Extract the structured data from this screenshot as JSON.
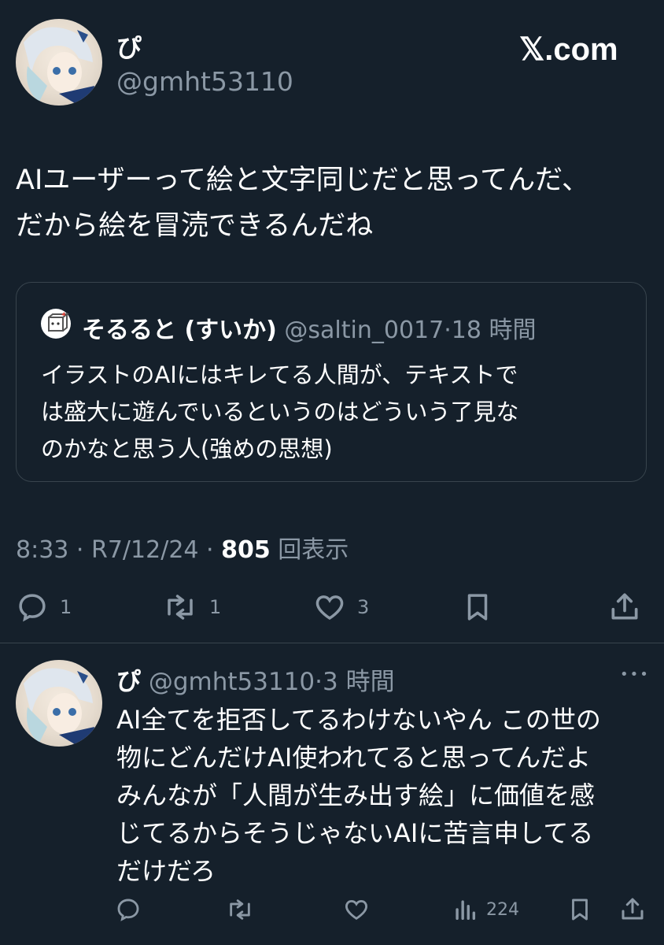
{
  "main_tweet": {
    "display_name": "ぴ",
    "handle": "@gmht53110",
    "site_label": "𝕏.com",
    "text_line1": "AIユーザーって絵と文字同じだと思ってんだ、",
    "text_line2": "だから絵を冒涜できるんだね",
    "quoted": {
      "display_name": "そるると (すいか)",
      "handle": "@saltin_0017",
      "time": "·18 時間",
      "line1": "イラストのAIにはキレてる人間が、テキストで",
      "line2": "は盛大に遊んでいるというのはどういう了見な",
      "line3": "のかなと思う人(強めの思想)"
    },
    "time": "8:33",
    "date": "· R7/12/24 ·",
    "views_count": "805",
    "views_label": "回表示",
    "replies": "1",
    "retweets": "1",
    "likes": "3"
  },
  "reply_tweet": {
    "display_name": "ぴ",
    "handle": "@gmht53110",
    "time": "·3 時間",
    "more": "•••",
    "line1": "AI全てを拒否してるわけないやん  この世の",
    "line2": "物にどんだけAI使われてると思ってんだよ",
    "line3": "みんなが「人間が生み出す絵」に価値を感",
    "line4": "じてるからそうじゃないAIに苦言申してる",
    "line5": "だけだろ",
    "views": "224"
  },
  "colors": {
    "background": "#15202b",
    "muted_text": "#8b98a5",
    "border": "#38444d",
    "text": "#ffffff"
  },
  "icons": [
    "avatar",
    "reply-icon",
    "retweet-icon",
    "like-icon",
    "bookmark-icon",
    "share-icon",
    "views-icon",
    "more-icon"
  ]
}
